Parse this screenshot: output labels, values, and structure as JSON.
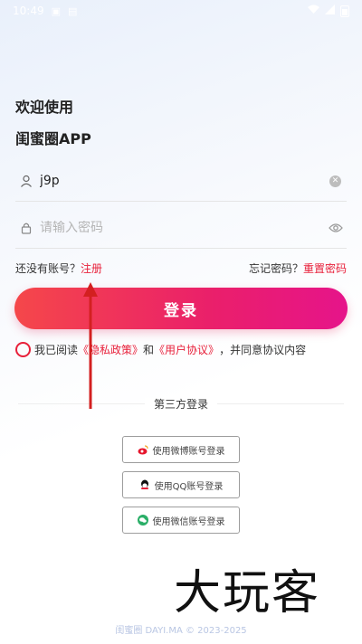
{
  "status_bar": {
    "time": "10:49"
  },
  "header": {
    "welcome": "欢迎使用",
    "app_name": "闺蜜圈APP"
  },
  "username": {
    "value": "j9p",
    "placeholder": ""
  },
  "password": {
    "value": "",
    "placeholder": "请输入密码"
  },
  "links": {
    "no_account": "还没有账号？",
    "register": "注册",
    "forgot": "忘记密码？",
    "reset": "重置密码"
  },
  "login_button": "登录",
  "agreement": {
    "prefix": "我已阅读",
    "privacy": "《隐私政策》",
    "and": "和",
    "user_agreement": "《用户协议》",
    "suffix": "，并同意协议内容"
  },
  "third_party": {
    "label": "第三方登录",
    "weibo": "使用微博账号登录",
    "qq": "使用QQ账号登录",
    "wechat": "使用微信账号登录"
  },
  "footer": "闺蜜圈 DAYI.MA © 2023-2025",
  "watermark": "大玩客",
  "colors": {
    "accent": "#e8203a",
    "gradient_start": "#f5474a",
    "gradient_end": "#e6148a"
  }
}
